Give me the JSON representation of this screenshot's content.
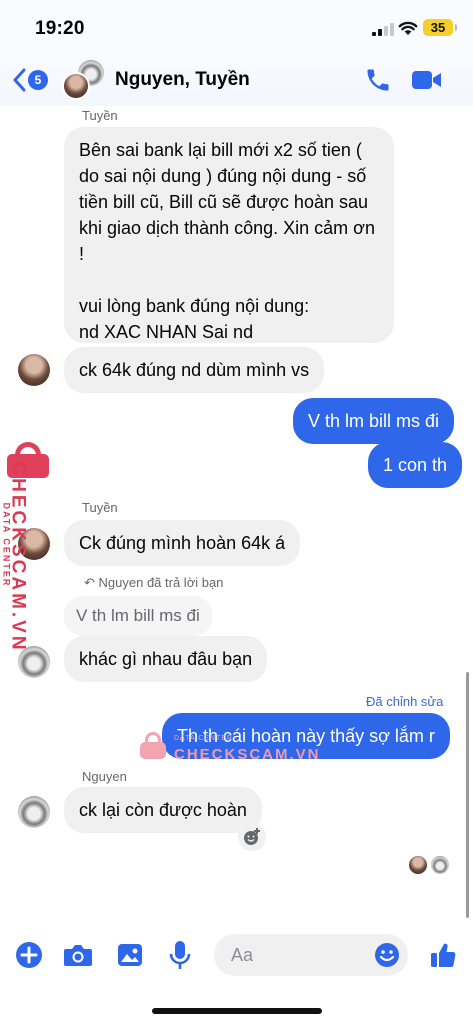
{
  "status_bar": {
    "time": "19:20",
    "battery": "35"
  },
  "header": {
    "back_count": "5",
    "contact_name": "Nguyen, Tuyền"
  },
  "messages": {
    "m1_sender": "Tuyền",
    "m1_text": "Bên sai bank lại bill mới x2 số tien ( do sai nội dung ) đúng nội dung - số tiền bill cũ, Bill cũ sẽ được hoàn sau khi giao dịch thành công. Xin cảm ơn !",
    "m1_text2": "vui lòng bank đúng nội dung:",
    "m1_text3": "nd XAC NHAN Sai nd",
    "m2_text": "ck 64k đúng nd dùm mình vs",
    "m3_text": "V th lm bill ms đi",
    "m4_text": "1 con th",
    "m5_sender": "Tuyền",
    "m5_text": "Ck đúng mình hoàn 64k á",
    "reply_note": "Nguyen đã trả lời bạn",
    "quoted_text": "V th lm bill ms đi",
    "m6_text": "khác gì nhau đâu bạn",
    "edited_label": "Đã chỉnh sửa",
    "m7_text": "Th th cái hoàn này thấy sợ lắm r",
    "m8_sender": "Nguyen",
    "m8_text": "ck lại còn được hoàn"
  },
  "watermark": {
    "brand": "CHECKSCAM.VN",
    "tagline": "DATA CENTER",
    "small_tagline": "DATA CENTER",
    "brand_center": "CHECKSCAM.VN"
  },
  "composer": {
    "placeholder": "Aa"
  },
  "colors": {
    "accent": "#2f67ea",
    "incoming_bubble": "#f0f0f0",
    "watermark": "#e0405a"
  },
  "icons": [
    "back-chevron-icon",
    "phone-icon",
    "video-camera-icon",
    "plus-icon",
    "camera-icon",
    "gallery-icon",
    "microphone-icon",
    "emoji-icon",
    "thumbs-up-icon",
    "reply-arrow-icon",
    "add-reaction-icon"
  ]
}
